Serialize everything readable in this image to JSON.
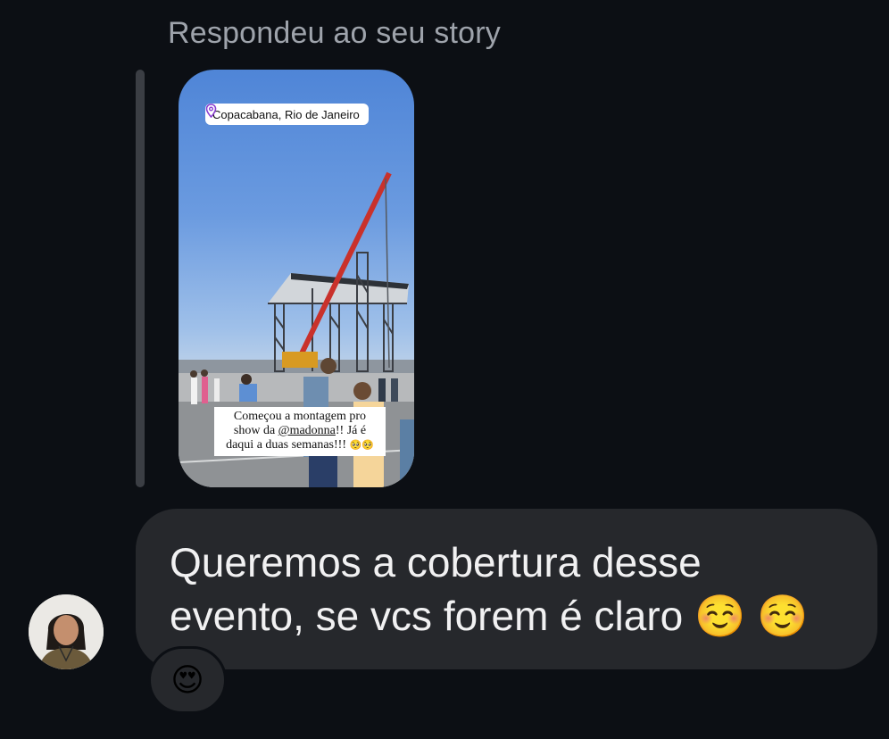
{
  "thread": {
    "reply_caption": "Respondeu ao seu story"
  },
  "story": {
    "location_label": "Copacabana, Rio de Janeiro",
    "caption_line1": "Começou a montagem pro",
    "caption_line2_prefix": "show da ",
    "caption_mention": "@madonna",
    "caption_line2_suffix": "!! Já é",
    "caption_line3": "daqui a duas semanas!!!"
  },
  "message": {
    "text_line1": "Queremos a cobertura desse",
    "text_line2": "evento, se vcs forem é claro",
    "reaction": "😍",
    "emoji": "☺️"
  },
  "colors": {
    "background": "#0c0f14",
    "bubble": "#26282c",
    "reply_line": "#3b3e44",
    "caption_text": "#9ea3ab"
  }
}
